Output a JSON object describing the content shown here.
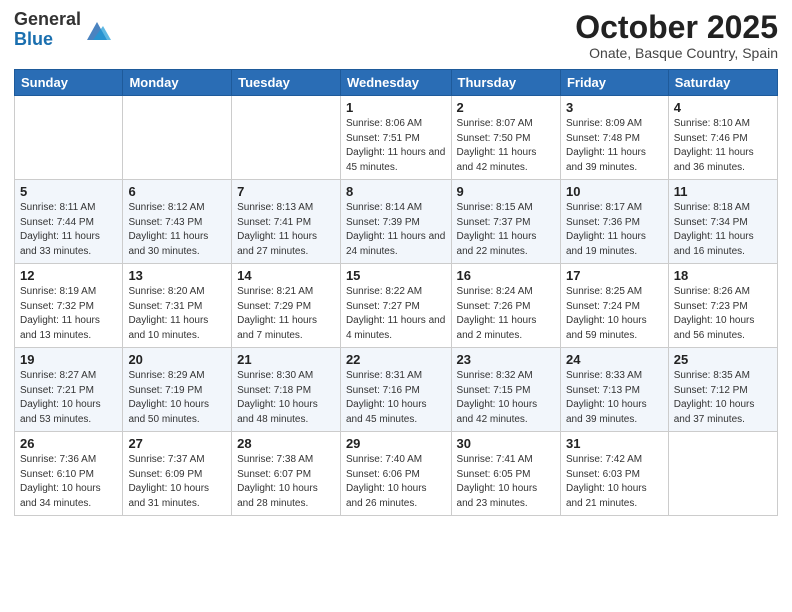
{
  "header": {
    "logo_general": "General",
    "logo_blue": "Blue",
    "month_title": "October 2025",
    "location": "Onate, Basque Country, Spain"
  },
  "weekdays": [
    "Sunday",
    "Monday",
    "Tuesday",
    "Wednesday",
    "Thursday",
    "Friday",
    "Saturday"
  ],
  "weeks": [
    [
      {
        "day": "",
        "info": ""
      },
      {
        "day": "",
        "info": ""
      },
      {
        "day": "",
        "info": ""
      },
      {
        "day": "1",
        "info": "Sunrise: 8:06 AM\nSunset: 7:51 PM\nDaylight: 11 hours and 45 minutes."
      },
      {
        "day": "2",
        "info": "Sunrise: 8:07 AM\nSunset: 7:50 PM\nDaylight: 11 hours and 42 minutes."
      },
      {
        "day": "3",
        "info": "Sunrise: 8:09 AM\nSunset: 7:48 PM\nDaylight: 11 hours and 39 minutes."
      },
      {
        "day": "4",
        "info": "Sunrise: 8:10 AM\nSunset: 7:46 PM\nDaylight: 11 hours and 36 minutes."
      }
    ],
    [
      {
        "day": "5",
        "info": "Sunrise: 8:11 AM\nSunset: 7:44 PM\nDaylight: 11 hours and 33 minutes."
      },
      {
        "day": "6",
        "info": "Sunrise: 8:12 AM\nSunset: 7:43 PM\nDaylight: 11 hours and 30 minutes."
      },
      {
        "day": "7",
        "info": "Sunrise: 8:13 AM\nSunset: 7:41 PM\nDaylight: 11 hours and 27 minutes."
      },
      {
        "day": "8",
        "info": "Sunrise: 8:14 AM\nSunset: 7:39 PM\nDaylight: 11 hours and 24 minutes."
      },
      {
        "day": "9",
        "info": "Sunrise: 8:15 AM\nSunset: 7:37 PM\nDaylight: 11 hours and 22 minutes."
      },
      {
        "day": "10",
        "info": "Sunrise: 8:17 AM\nSunset: 7:36 PM\nDaylight: 11 hours and 19 minutes."
      },
      {
        "day": "11",
        "info": "Sunrise: 8:18 AM\nSunset: 7:34 PM\nDaylight: 11 hours and 16 minutes."
      }
    ],
    [
      {
        "day": "12",
        "info": "Sunrise: 8:19 AM\nSunset: 7:32 PM\nDaylight: 11 hours and 13 minutes."
      },
      {
        "day": "13",
        "info": "Sunrise: 8:20 AM\nSunset: 7:31 PM\nDaylight: 11 hours and 10 minutes."
      },
      {
        "day": "14",
        "info": "Sunrise: 8:21 AM\nSunset: 7:29 PM\nDaylight: 11 hours and 7 minutes."
      },
      {
        "day": "15",
        "info": "Sunrise: 8:22 AM\nSunset: 7:27 PM\nDaylight: 11 hours and 4 minutes."
      },
      {
        "day": "16",
        "info": "Sunrise: 8:24 AM\nSunset: 7:26 PM\nDaylight: 11 hours and 2 minutes."
      },
      {
        "day": "17",
        "info": "Sunrise: 8:25 AM\nSunset: 7:24 PM\nDaylight: 10 hours and 59 minutes."
      },
      {
        "day": "18",
        "info": "Sunrise: 8:26 AM\nSunset: 7:23 PM\nDaylight: 10 hours and 56 minutes."
      }
    ],
    [
      {
        "day": "19",
        "info": "Sunrise: 8:27 AM\nSunset: 7:21 PM\nDaylight: 10 hours and 53 minutes."
      },
      {
        "day": "20",
        "info": "Sunrise: 8:29 AM\nSunset: 7:19 PM\nDaylight: 10 hours and 50 minutes."
      },
      {
        "day": "21",
        "info": "Sunrise: 8:30 AM\nSunset: 7:18 PM\nDaylight: 10 hours and 48 minutes."
      },
      {
        "day": "22",
        "info": "Sunrise: 8:31 AM\nSunset: 7:16 PM\nDaylight: 10 hours and 45 minutes."
      },
      {
        "day": "23",
        "info": "Sunrise: 8:32 AM\nSunset: 7:15 PM\nDaylight: 10 hours and 42 minutes."
      },
      {
        "day": "24",
        "info": "Sunrise: 8:33 AM\nSunset: 7:13 PM\nDaylight: 10 hours and 39 minutes."
      },
      {
        "day": "25",
        "info": "Sunrise: 8:35 AM\nSunset: 7:12 PM\nDaylight: 10 hours and 37 minutes."
      }
    ],
    [
      {
        "day": "26",
        "info": "Sunrise: 7:36 AM\nSunset: 6:10 PM\nDaylight: 10 hours and 34 minutes."
      },
      {
        "day": "27",
        "info": "Sunrise: 7:37 AM\nSunset: 6:09 PM\nDaylight: 10 hours and 31 minutes."
      },
      {
        "day": "28",
        "info": "Sunrise: 7:38 AM\nSunset: 6:07 PM\nDaylight: 10 hours and 28 minutes."
      },
      {
        "day": "29",
        "info": "Sunrise: 7:40 AM\nSunset: 6:06 PM\nDaylight: 10 hours and 26 minutes."
      },
      {
        "day": "30",
        "info": "Sunrise: 7:41 AM\nSunset: 6:05 PM\nDaylight: 10 hours and 23 minutes."
      },
      {
        "day": "31",
        "info": "Sunrise: 7:42 AM\nSunset: 6:03 PM\nDaylight: 10 hours and 21 minutes."
      },
      {
        "day": "",
        "info": ""
      }
    ]
  ]
}
